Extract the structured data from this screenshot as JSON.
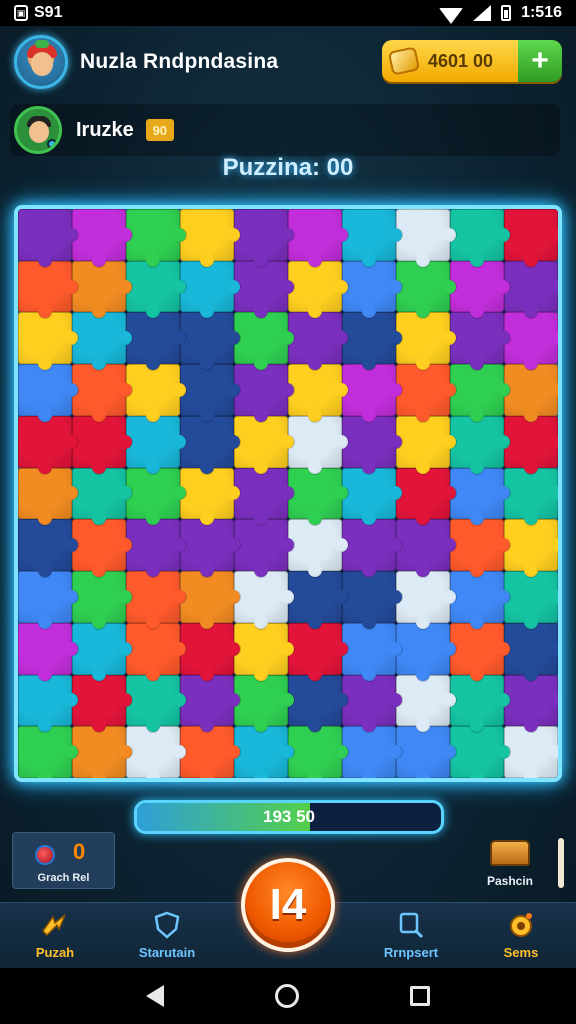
{
  "status_bar": {
    "left_text": "S91",
    "time": "1:516"
  },
  "header": {
    "player_name": "Nuzla Rndpndasina",
    "coins": "4601 00",
    "add_coins_label": "+"
  },
  "opponent": {
    "name": "Iruzke",
    "badge": "90"
  },
  "puzzle": {
    "title": "Puzzina: 00",
    "progress_text": "193 50",
    "progress_fraction": 0.57,
    "palette": [
      "#19b7d9",
      "#2fcf52",
      "#ffcf20",
      "#ff5a2c",
      "#e3143a",
      "#7b2fbf",
      "#c22edb",
      "#14c4a3",
      "#3f88f5",
      "#f28c22",
      "#dceaf5",
      "#244a9a"
    ]
  },
  "bottom": {
    "left_card": {
      "count": "0",
      "label": "Grach Rel"
    },
    "right_item": {
      "label": "Pashcin"
    },
    "center_button": "I4"
  },
  "nav": {
    "items": [
      {
        "label": "Puzah",
        "icon": "lightning-icon",
        "color": "#ffbf2a"
      },
      {
        "label": "Starutain",
        "icon": "shield-icon",
        "color": "#6ec6ff"
      },
      {
        "label": "Rrnpsert",
        "icon": "search-icon",
        "color": "#6ec6ff"
      },
      {
        "label": "Sems",
        "icon": "gear-icon",
        "color": "#ffbf2a"
      }
    ]
  }
}
